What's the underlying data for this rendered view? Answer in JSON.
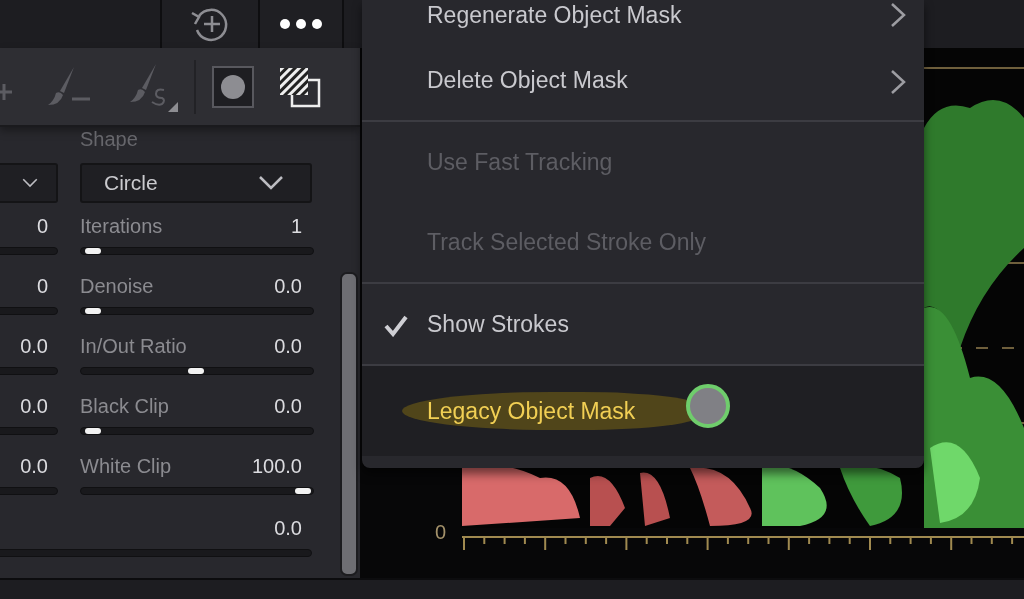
{
  "panel": {
    "shape_label": "Shape",
    "shape_dropdown": {
      "value": "Circle"
    },
    "left_values": [
      "0",
      "0",
      "0.0",
      "0.0",
      "0.0"
    ],
    "params": [
      {
        "label": "Iterations",
        "value": "1",
        "level": 0.02
      },
      {
        "label": "Denoise",
        "value": "0.0",
        "level": 0.02
      },
      {
        "label": "In/Out Ratio",
        "value": "0.0",
        "level": 0.5
      },
      {
        "label": "Black Clip",
        "value": "0.0",
        "level": 0.02
      },
      {
        "label": "White Clip",
        "value": "100.0",
        "level": 1.0
      }
    ],
    "bottom_value": "0.0"
  },
  "menu": {
    "sections": [
      [
        {
          "label": "Regenerate Object Mask",
          "kind": "submenu",
          "disabled": false,
          "checked": false,
          "highlighted": false
        },
        {
          "label": "Delete Object Mask",
          "kind": "submenu",
          "disabled": false,
          "checked": false,
          "highlighted": false
        }
      ],
      [
        {
          "label": "Use Fast Tracking",
          "kind": "toggle",
          "disabled": true,
          "checked": false,
          "highlighted": false
        },
        {
          "label": "Track Selected Stroke Only",
          "kind": "toggle",
          "disabled": true,
          "checked": false,
          "highlighted": false
        }
      ],
      [
        {
          "label": "Show Strokes",
          "kind": "toggle",
          "disabled": false,
          "checked": true,
          "highlighted": false
        }
      ],
      [
        {
          "label": "Legacy Object Mask",
          "kind": "toggle",
          "disabled": false,
          "checked": false,
          "highlighted": true,
          "touch": true
        }
      ]
    ]
  },
  "scope": {
    "scale_label": "0"
  }
}
